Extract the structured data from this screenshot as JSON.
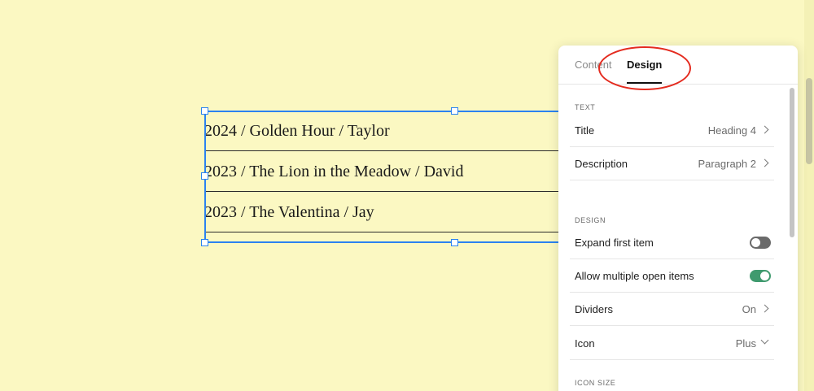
{
  "canvas": {
    "accordion_items": [
      "2024 / Golden Hour / Taylor",
      "2023 / The Lion in the Meadow / David",
      "2023 / The Valentina / Jay"
    ]
  },
  "panel": {
    "tabs": [
      {
        "label": "Content",
        "active": false
      },
      {
        "label": "Design",
        "active": true
      }
    ],
    "text_section": {
      "label": "TEXT",
      "rows": [
        {
          "label": "Title",
          "value": "Heading 4"
        },
        {
          "label": "Description",
          "value": "Paragraph 2"
        }
      ]
    },
    "design_section": {
      "label": "DESIGN",
      "expand_first_item": {
        "label": "Expand first item",
        "on": false
      },
      "allow_multiple_open": {
        "label": "Allow multiple open items",
        "on": true
      },
      "dividers": {
        "label": "Dividers",
        "value": "On"
      },
      "icon": {
        "label": "Icon",
        "value": "Plus"
      }
    },
    "icon_size_section": {
      "label": "ICON SIZE"
    }
  },
  "colors": {
    "canvas_background": "#fbf8c2",
    "selection": "#2b82f0",
    "annotation": "#e42b1f",
    "toggle_on": "#3f9a6e",
    "toggle_off": "#6a6a6a"
  }
}
